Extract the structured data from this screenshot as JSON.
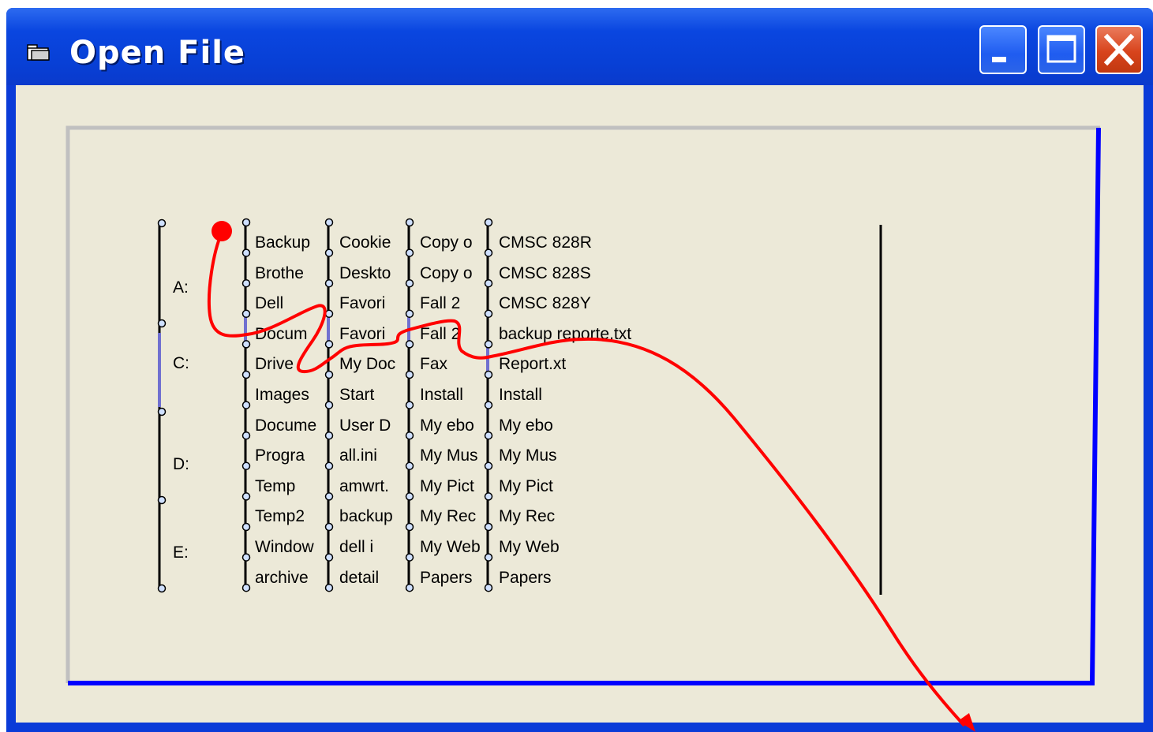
{
  "window": {
    "title": "Open File",
    "title_icon": "folder-icon",
    "buttons": [
      "minimize-icon",
      "maximize-icon",
      "close-icon"
    ]
  },
  "drives": [
    "A:",
    "C:",
    "D:",
    "E:"
  ],
  "columns": [
    {
      "items": [
        "Backup",
        "Brothe",
        "Dell",
        "Docum",
        "Drive",
        "Images",
        "Docume",
        "Progra",
        "Temp",
        "Temp2",
        "Window",
        "archive"
      ]
    },
    {
      "items": [
        "Cookie",
        "Deskto",
        "Favori",
        "Favori",
        "My Doc",
        "Start",
        "User D",
        "all.ini",
        "amwrt.",
        "backup",
        "dell i",
        "detail"
      ]
    },
    {
      "items": [
        "Copy o",
        "Copy o",
        "Fall 2",
        "Fall 2",
        "Fax",
        "Install",
        "My ebo",
        "My Mus",
        "My Pict",
        "My Rec",
        "My Web",
        "Papers"
      ]
    },
    {
      "items": [
        "CMSC 828R",
        "CMSC 828S",
        "CMSC 828Y",
        "backup reporte.txt",
        "Report.xt",
        "Install",
        "My ebo",
        "My Mus",
        "My Pict",
        "My Rec",
        "My Web",
        "Papers"
      ]
    }
  ],
  "colors": {
    "titlebar": "#0a46e0",
    "client": "#ece9d8",
    "frame_light": "#c0c0c0",
    "frame_dark": "#0000ff",
    "path": "#ff0000",
    "selection_bar": "#7070d0"
  }
}
